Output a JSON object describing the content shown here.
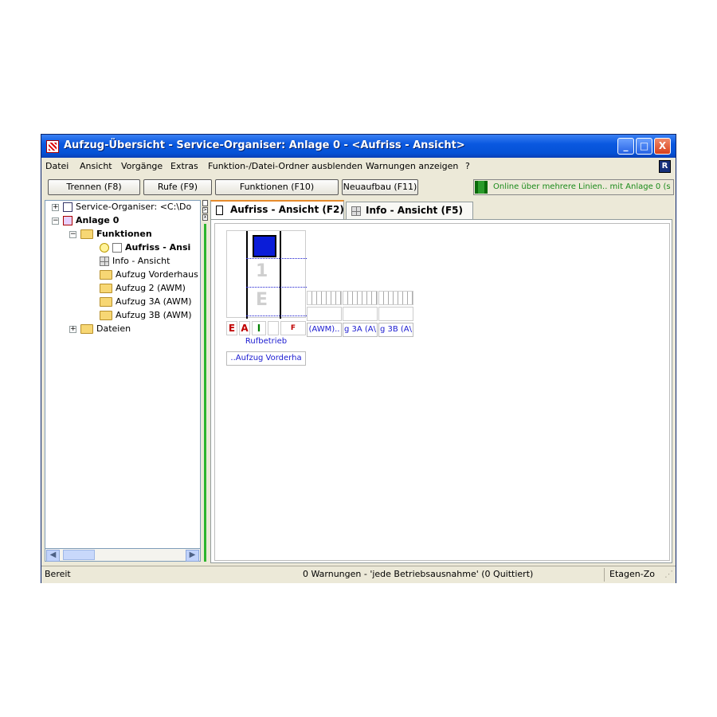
{
  "window": {
    "title": "Aufzug-Übersicht - Service-Organiser: Anlage 0 -  <Aufriss - Ansicht>",
    "controls": [
      "_",
      "□",
      "X"
    ]
  },
  "menu": [
    "Datei",
    "Ansicht",
    "Vorgänge",
    "Extras",
    "Funktion-/Datei-Ordner ausblenden",
    "Warnungen anzeigen",
    "?"
  ],
  "toolbar": {
    "buttons": [
      "Trennen (F8)",
      "Rufe (F9)",
      "Funktionen (F10)",
      "Neuaufbau (F11)"
    ],
    "online_status": "Online über mehrere Linien.. mit Anlage 0 (s"
  },
  "tree": {
    "root": "Service-Organiser: <C:\\Do",
    "plant": "Anlage 0",
    "functions_folder": "Funktionen",
    "items": [
      "Aufriss - Ansi",
      "Info - Ansicht",
      "Aufzug Vorderhaus",
      "Aufzug 2 (AWM)",
      "Aufzug 3A (AWM)",
      "Aufzug 3B (AWM)"
    ],
    "files_folder": "Dateien"
  },
  "tabs": [
    "Aufriss - Ansicht (F2)",
    "Info - Ansicht (F5)"
  ],
  "elevator": {
    "floors": [
      "1",
      "E"
    ],
    "status_letters": [
      "E",
      "A",
      "I",
      "",
      "F"
    ],
    "status_colors": {
      "E": "#c00000",
      "A": "#c00000",
      "I": "#008000",
      "F": "#c00000"
    },
    "mode": "Rufbetrieb",
    "name": "..Aufzug Vorderha",
    "other_elevators": [
      "(AWM)..",
      "g 3A (A\\",
      "g 3B (A\\"
    ]
  },
  "statusbar": {
    "left": "Bereit",
    "center": "0 Warnungen - 'jede Betriebsausnahme' (0 Quittiert)",
    "right": "Etagen-Zo"
  }
}
